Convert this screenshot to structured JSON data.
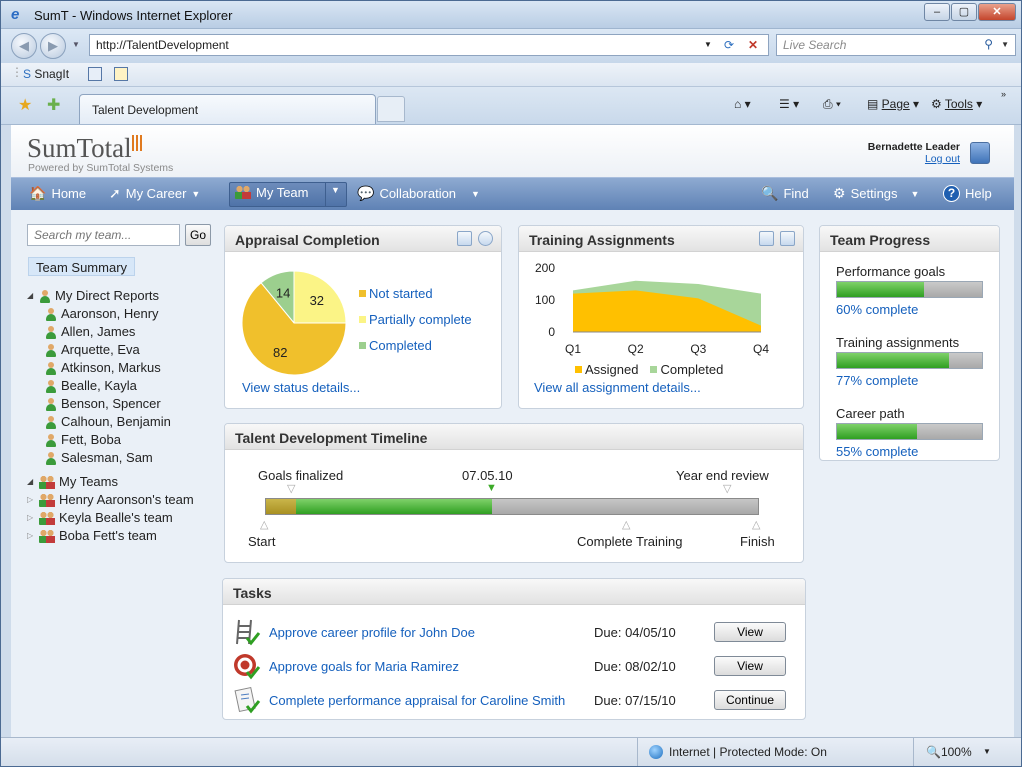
{
  "browser": {
    "title": "SumT  - Windows Internet Explorer",
    "url": "http://TalentDevelopment",
    "search_placeholder": "Live Search",
    "toolbar": {
      "snagit": "SnagIt"
    },
    "tab_label": "Talent Development",
    "commands": {
      "page": "Page",
      "tools": "Tools"
    },
    "status": {
      "zone": "Internet | Protected Mode: On",
      "zoom": "100%"
    }
  },
  "header": {
    "logo_text": "SumTotal",
    "powered_by": "Powered by SumTotal Systems",
    "user_name": "Bernadette Leader",
    "logout": "Log out"
  },
  "nav": {
    "home": "Home",
    "my_career": "My Career",
    "my_team": "My Team",
    "collaboration": "Collaboration",
    "find": "Find",
    "settings": "Settings",
    "help": "Help"
  },
  "sidebar": {
    "search_placeholder": "Search my team...",
    "go": "Go",
    "team_summary": "Team Summary",
    "direct_reports_label": "My Direct Reports",
    "direct_reports": [
      "Aaronson, Henry",
      "Allen, James",
      "Arquette, Eva",
      "Atkinson, Markus",
      "Bealle, Kayla",
      "Benson, Spencer",
      "Calhoun, Benjamin",
      "Fett, Boba",
      "Salesman, Sam"
    ],
    "my_teams_label": "My Teams",
    "teams": [
      "Henry Aaronson's team",
      "Keyla Bealle's team",
      "Boba Fett's team"
    ]
  },
  "appraisal": {
    "title": "Appraisal Completion",
    "link": "View status details...",
    "chart_data": {
      "type": "pie",
      "categories": [
        "Not started",
        "Partially complete",
        "Completed"
      ],
      "values": [
        82,
        32,
        14
      ],
      "colors": [
        "#f0c02c",
        "#fbf486",
        "#9ccf8e"
      ]
    }
  },
  "training": {
    "title": "Training Assignments",
    "link": "View all assignment details...",
    "chart_data": {
      "type": "area",
      "categories": [
        "Q1",
        "Q2",
        "Q3",
        "Q4"
      ],
      "series": [
        {
          "name": "Assigned",
          "values": [
            120,
            130,
            105,
            20
          ],
          "color": "#ffc000"
        },
        {
          "name": "Completed",
          "values": [
            130,
            160,
            150,
            120
          ],
          "color": "#a8d69a"
        }
      ],
      "yticks": [
        "200",
        "100",
        "0"
      ],
      "ylim": [
        0,
        200
      ]
    }
  },
  "team_progress": {
    "title": "Team Progress",
    "items": [
      {
        "label": "Performance goals",
        "pct": 0.6,
        "text": "60% complete"
      },
      {
        "label": "Training assignments",
        "pct": 0.77,
        "text": "77% complete"
      },
      {
        "label": "Career path",
        "pct": 0.55,
        "text": "55% complete"
      }
    ]
  },
  "timeline": {
    "title": "Talent Development Timeline",
    "top_labels": {
      "goals": "Goals finalized",
      "date": "07.05.10",
      "review": "Year end review"
    },
    "bottom_labels": {
      "start": "Start",
      "training": "Complete Training",
      "finish": "Finish"
    },
    "progress_fraction": 0.46,
    "early_fraction": 0.06
  },
  "tasks": {
    "title": "Tasks",
    "items": [
      {
        "title": "Approve career profile for John Doe",
        "due": "Due: 04/05/10",
        "action": "View",
        "icon": "ladder-icon"
      },
      {
        "title": "Approve goals for Maria Ramirez",
        "due": "Due: 08/02/10",
        "action": "View",
        "icon": "target-icon"
      },
      {
        "title": "Complete performance appraisal for Caroline Smith",
        "due": "Due: 07/15/10",
        "action": "Continue",
        "icon": "appraisal-icon"
      }
    ]
  }
}
